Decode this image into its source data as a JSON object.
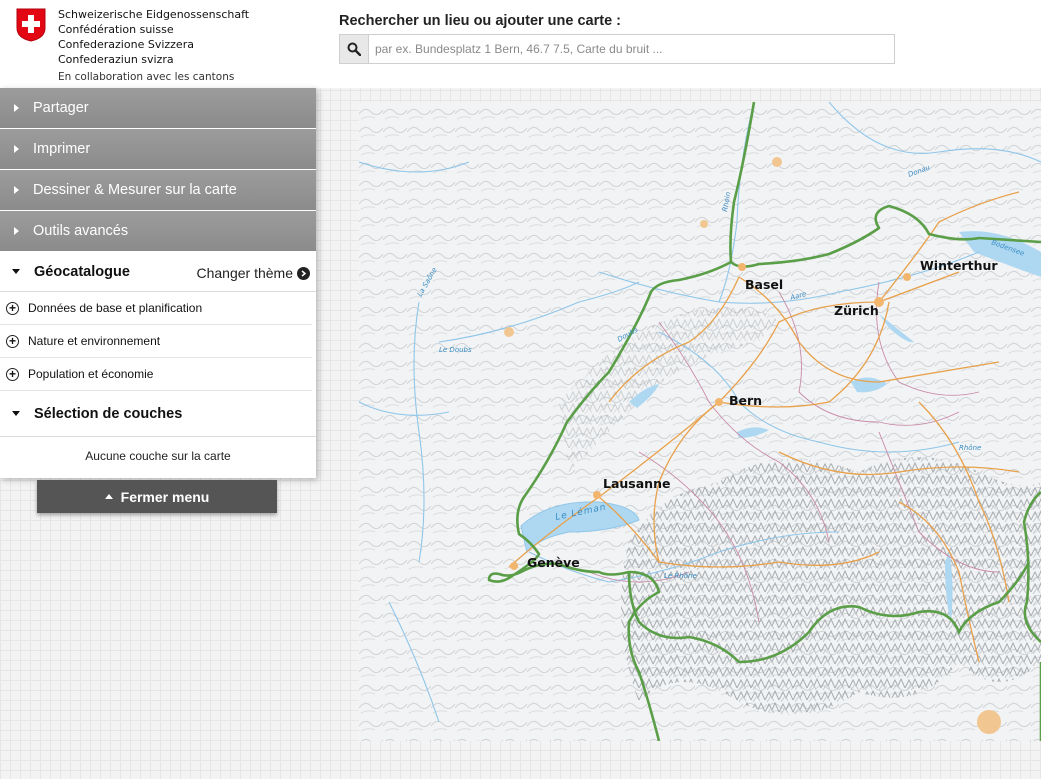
{
  "header": {
    "confederation": [
      "Schweizerische Eidgenossenschaft",
      "Confédération suisse",
      "Confederazione Svizzera",
      "Confederaziun svizra"
    ],
    "collaboration": "En collaboration avec les cantons",
    "search_label": "Rechercher un lieu ou ajouter une carte :",
    "search_placeholder": "par ex. Bundesplatz 1 Bern, 46.7 7.5, Carte du bruit ..."
  },
  "menu": {
    "collapsed_sections": [
      "Partager",
      "Imprimer",
      "Dessiner & Mesurer sur la carte",
      "Outils avancés"
    ],
    "geocatalog": {
      "title": "Géocatalogue",
      "change_theme": "Changer thème",
      "categories": [
        "Données de base et planification",
        "Nature et environnement",
        "Population et économie"
      ]
    },
    "layer_selection": {
      "title": "Sélection de couches",
      "empty_text": "Aucune couche sur la carte"
    },
    "close_label": "Fermer menu"
  },
  "map": {
    "cities": [
      "Basel",
      "Zürich",
      "Winterthur",
      "Bern",
      "Lausanne",
      "Genève"
    ],
    "rivers": [
      "Rhein",
      "Doubs",
      "La Saône",
      "Le Doubs",
      "Aare",
      "Rhône",
      "Le Rhône",
      "Donau",
      "Bodensee"
    ],
    "lake": "Le Léman",
    "colors": {
      "border": "#5a9e48",
      "roads": "#e8a04a",
      "cantonal_borders": "#c98aa8",
      "water": "#8fc6ea",
      "lake_fill": "#aed8f1"
    }
  }
}
